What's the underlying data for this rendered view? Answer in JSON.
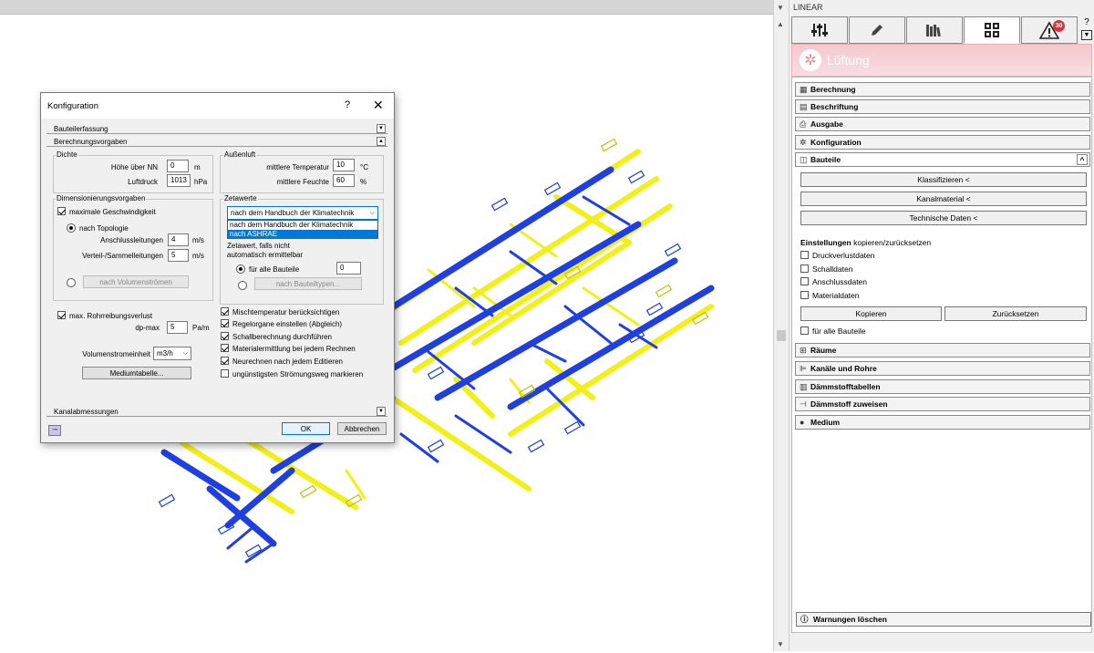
{
  "panel": {
    "title": "LINEAR",
    "header": "Lüftung",
    "tabs": [
      {
        "icon": "sliders-icon"
      },
      {
        "icon": "pencil-icon"
      },
      {
        "icon": "books-icon"
      },
      {
        "icon": "grid-icon",
        "active": true
      },
      {
        "icon": "warning-icon",
        "badge": "30"
      }
    ],
    "help": "?",
    "sections_top": [
      "Berechnung",
      "Beschriftung",
      "Ausgabe",
      "Konfiguration",
      "Bauteile"
    ],
    "bauteile_buttons": [
      "Klassifizieren  <",
      "Kanalmaterial  <",
      "Technische Daten  <"
    ],
    "settings_label_bold": "Einstellungen",
    "settings_label_rest": " kopieren/zurücksetzen",
    "settings_checks": [
      "Druckverlustdaten",
      "Schalldaten",
      "Anschlussdaten",
      "Materialdaten"
    ],
    "copy_button": "Kopieren",
    "reset_button": "Zurücksetzen",
    "all_parts_check": "für alle Bauteile",
    "sections_bottom": [
      "Räume",
      "Kanäle und Rohre",
      "Dämmstofftabellen",
      "Dämmstoff zuweisen",
      "Medium"
    ],
    "warnings_button": "Warnungen löschen"
  },
  "dialog": {
    "title": "Konfiguration",
    "help": "?",
    "close": "✕",
    "sec_bauteilerfassung": "Bauteilerfassung",
    "sec_berechnungsvorgaben": "Berechnungsvorgaben",
    "sec_kanalabmessungen": "Kanalabmessungen",
    "dichte": {
      "label": "Dichte",
      "hoehe_label": "Höhe über NN",
      "hoehe_value": "0",
      "hoehe_unit": "m",
      "luftdruck_label": "Luftdruck",
      "luftdruck_value": "1013",
      "luftdruck_unit": "hPa"
    },
    "aussenluft": {
      "label": "Außenluft",
      "temp_label": "mittlere Temperatur",
      "temp_value": "10",
      "temp_unit": "°C",
      "feuchte_label": "mittlere Feuchte",
      "feuchte_value": "60",
      "feuchte_unit": "%"
    },
    "dimension": {
      "label": "Dimensionierungsvorgaben",
      "max_speed": "maximale Geschwindigkeit",
      "topologie": "nach Topologie",
      "anschluss_label": "Anschlussleitungen",
      "anschluss_value": "4",
      "anschluss_unit": "m/s",
      "verteil_label": "Verteil-/Sammelleitungen",
      "verteil_value": "5",
      "verteil_unit": "m/s",
      "volumen_button": "nach Volumenströmen",
      "rohr": "max. Rohrreibungsverlust",
      "dpmax_label": "dp-max",
      "dpmax_value": "5",
      "dpmax_unit": "Pa/m"
    },
    "volumeneinheit_label": "Volumenstromeinheit",
    "volumeneinheit_value": "m3/h",
    "medium_button": "Mediumtabelle...",
    "zeta": {
      "label": "Zetawerte",
      "selected": "nach dem Handbuch der Klimatechnik",
      "options": [
        "nach dem Handbuch der Klimatechnik",
        "nach ASHRAE"
      ],
      "text1": "Zetawert, falls nicht",
      "text2": "automatisch ermittelbar",
      "all_label": "für alle Bauteile",
      "all_value": "0",
      "types_button": "nach Bauteiltypen..."
    },
    "options": [
      {
        "label": "Mischtemperatur berücksichtigen",
        "checked": true
      },
      {
        "label": "Regelorgane einstellen (Abgleich)",
        "checked": true
      },
      {
        "label": "Schallberechnung durchführen",
        "checked": true
      },
      {
        "label": "Materialermittlung bei jedem Rechnen",
        "checked": true
      },
      {
        "label": "Neurechnen nach jedem Editieren",
        "checked": true
      },
      {
        "label": "ungünstigsten Strömungsweg markieren",
        "checked": false
      }
    ],
    "ok": "OK",
    "cancel": "Abbrechen"
  }
}
